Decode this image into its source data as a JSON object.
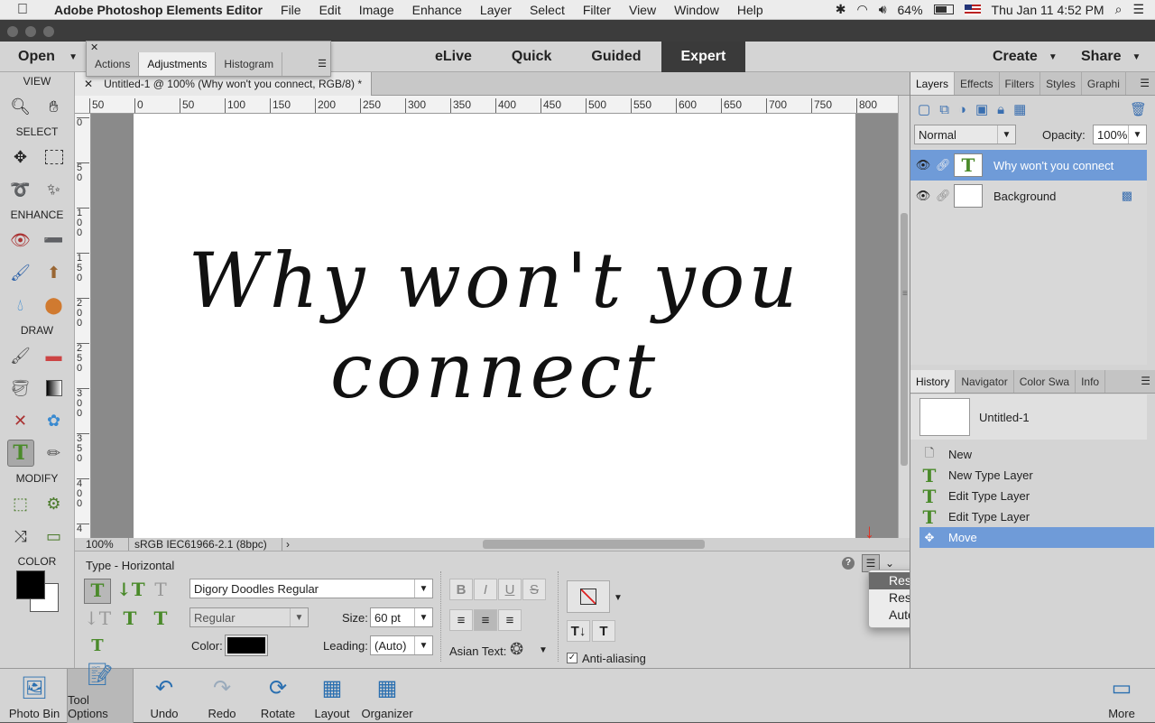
{
  "menubar": {
    "apple": "",
    "app_name": "Adobe Photoshop Elements Editor",
    "items": [
      "File",
      "Edit",
      "Image",
      "Enhance",
      "Layer",
      "Select",
      "Filter",
      "View",
      "Window",
      "Help"
    ],
    "battery": "64%",
    "clock": "Thu Jan 11  4:52 PM"
  },
  "modebar": {
    "open": "Open",
    "modes": [
      "eLive",
      "Quick",
      "Guided",
      "Expert"
    ],
    "active_mode": "Expert",
    "create": "Create",
    "share": "Share"
  },
  "floatpanel": {
    "tabs": [
      "Actions",
      "Adjustments",
      "Histogram"
    ],
    "active_tab": "Adjustments"
  },
  "toolbox": {
    "sections": [
      "VIEW",
      "SELECT",
      "ENHANCE",
      "DRAW",
      "MODIFY",
      "COLOR"
    ]
  },
  "document": {
    "tab_title": "Untitled-1 @ 100% (Why won't you connect, RGB/8) *",
    "canvas_line1": "Why won't you",
    "canvas_line2": "connect",
    "zoom": "100%",
    "profile": "sRGB IEC61966-2.1 (8bpc)",
    "hruler_labels": [
      "50",
      "0",
      "50",
      "100",
      "150",
      "200",
      "250",
      "300",
      "350",
      "400",
      "450",
      "500",
      "550",
      "600",
      "650",
      "700",
      "750",
      "800"
    ],
    "vruler_labels": [
      "0",
      "5\n0",
      "1\n0\n0",
      "1\n5\n0",
      "2\n0\n0",
      "2\n5\n0",
      "3\n0\n0",
      "3\n5\n0",
      "4\n0\n0",
      "4"
    ]
  },
  "tool_options": {
    "title": "Type - Horizontal",
    "font": "Digory Doodles Regular",
    "style": "Regular",
    "size_label": "Size:",
    "size": "60 pt",
    "color_label": "Color:",
    "leading_label": "Leading:",
    "leading": "(Auto)",
    "asian_label": "Asian Text:",
    "antialias_label": "Anti-aliasing",
    "antialias_checked": true
  },
  "popup": {
    "items": [
      "Reset Tool",
      "Reset All Tools",
      "Auto Show Tool Options"
    ],
    "selected": "Reset Tool"
  },
  "layers_panel": {
    "tabs": [
      "Layers",
      "Effects",
      "Filters",
      "Styles",
      "Graphi"
    ],
    "active_tab": "Layers",
    "blend_mode": "Normal",
    "opacity_label": "Opacity:",
    "opacity": "100%",
    "layers": [
      {
        "name": "Why won't you connect",
        "selected": true
      },
      {
        "name": "Background",
        "selected": false
      }
    ]
  },
  "history_panel": {
    "tabs": [
      "History",
      "Navigator",
      "Color Swa",
      "Info"
    ],
    "active_tab": "History",
    "snapshot": "Untitled-1",
    "items": [
      "New",
      "New Type Layer",
      "Edit Type Layer",
      "Edit Type Layer",
      "Move"
    ],
    "selected_index": 4
  },
  "bottombar": {
    "buttons": [
      "Photo Bin",
      "Tool Options",
      "Undo",
      "Redo",
      "Rotate",
      "Layout",
      "Organizer"
    ],
    "more": "More"
  },
  "colors": {
    "accent_blue": "#6f9bd8",
    "foreground_color": "#000000",
    "background_color": "#ffffff",
    "annotation_arrow": "#e03020"
  }
}
